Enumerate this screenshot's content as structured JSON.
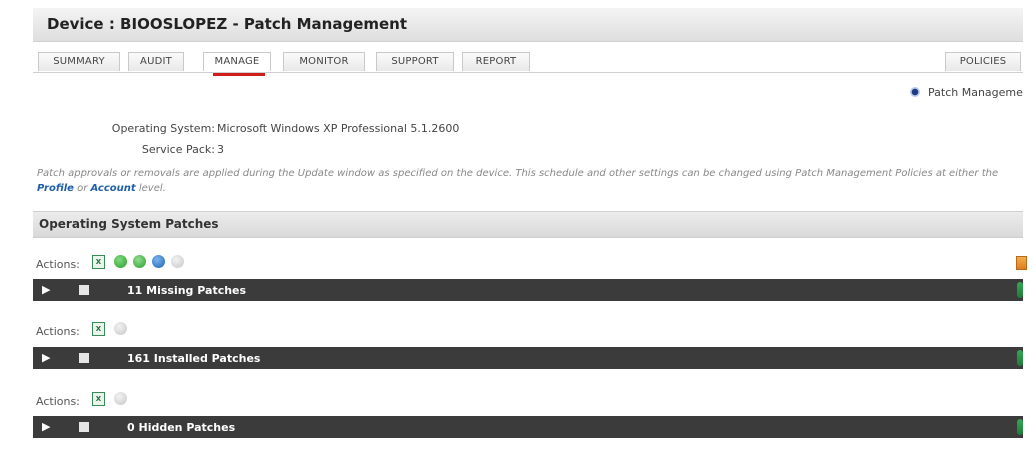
{
  "header": {
    "title": "Device : BIOOSLOPEZ - Patch Management"
  },
  "tabs": [
    {
      "label": "SUMMARY",
      "active": false
    },
    {
      "label": "AUDIT",
      "active": false
    },
    {
      "label": "MANAGE",
      "active": true
    },
    {
      "label": "MONITOR",
      "active": false
    },
    {
      "label": "SUPPORT",
      "active": false
    },
    {
      "label": "REPORT",
      "active": false
    },
    {
      "label": "POLICIES",
      "active": false
    }
  ],
  "radio": {
    "label": "Patch Manageme"
  },
  "info": {
    "os_label": "Operating System:",
    "os_value": "Microsoft Windows XP Professional 5.1.2600",
    "sp_label": "Service Pack:",
    "sp_value": "3"
  },
  "note": {
    "text1": "Patch approvals or removals are applied during the Update window as specified on the device. This schedule and other settings can be changed using Patch Management Policies at either the ",
    "link_profile": "Profile",
    "text2": " or ",
    "link_account": "Account",
    "text3": " level."
  },
  "section": {
    "title": "Operating System Patches"
  },
  "actions_label": "Actions:",
  "groups": [
    {
      "label": "11 Missing Patches"
    },
    {
      "label": "161 Installed Patches"
    },
    {
      "label": "0 Hidden Patches"
    }
  ],
  "icons": {
    "export": "xls-export-icon",
    "approve": "green-circle-icon",
    "install": "green-arrow-icon",
    "info": "blue-circle-icon",
    "disabled": "gray-circle-icon"
  },
  "colors": {
    "bar": "#3b3b3b",
    "active_tab_underline": "#d21b1b",
    "link": "#1f5fa8"
  }
}
